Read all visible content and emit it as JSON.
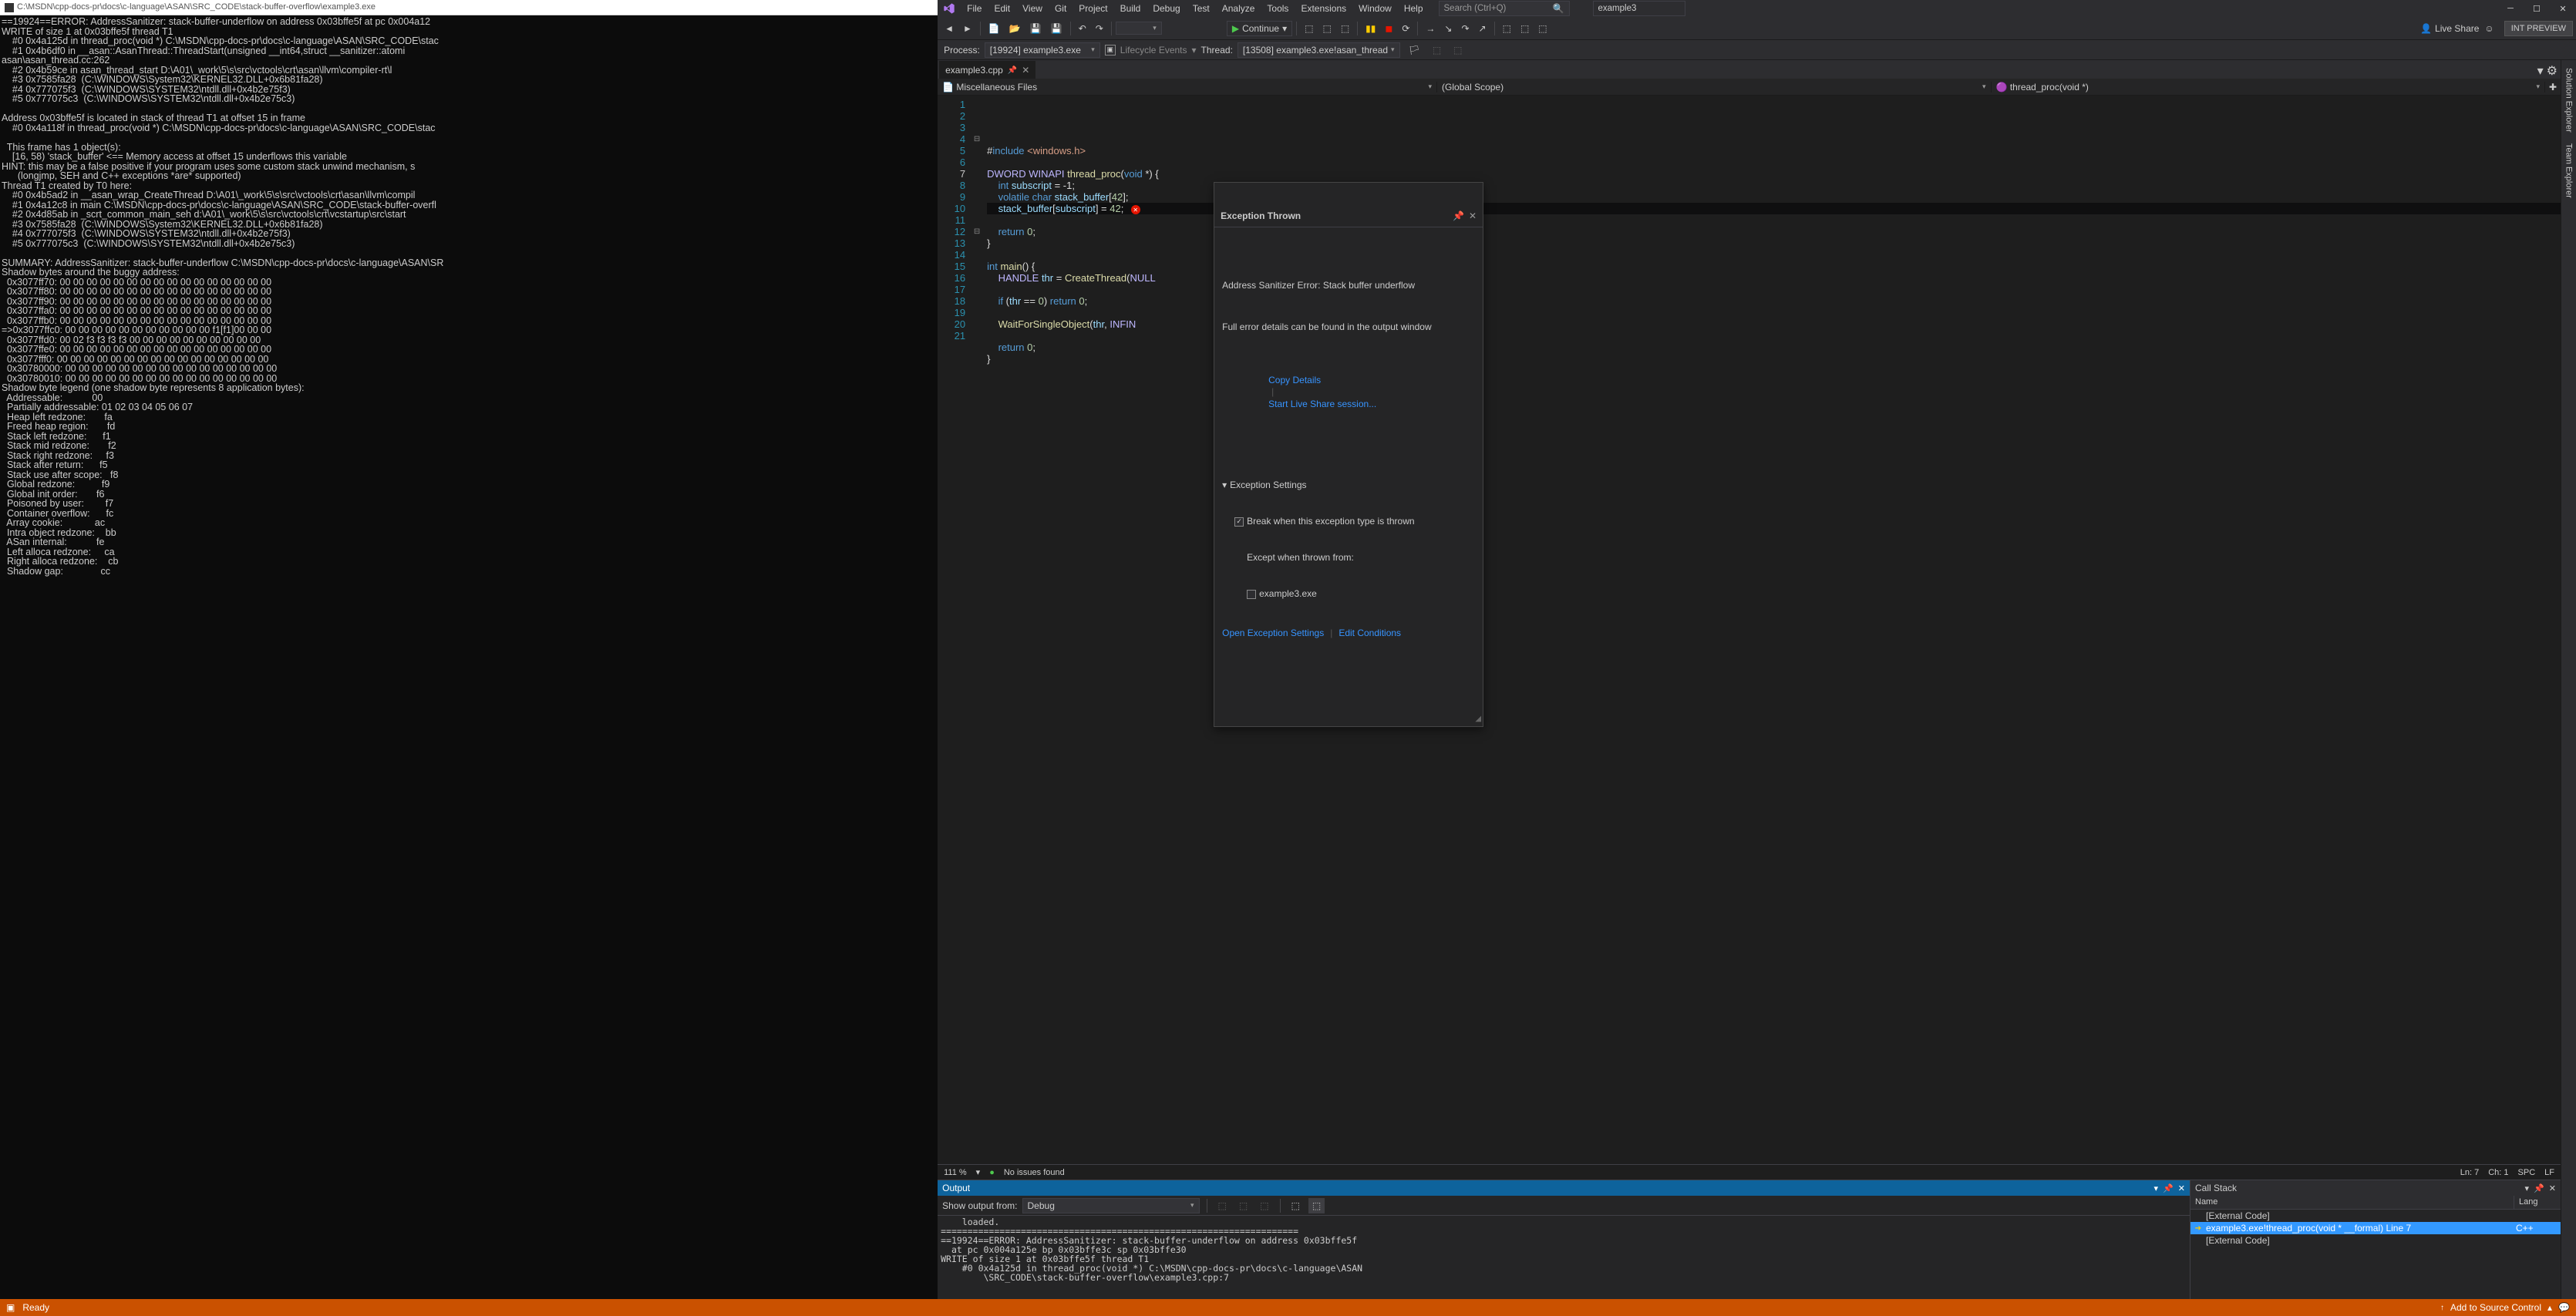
{
  "console": {
    "title": "C:\\MSDN\\cpp-docs-pr\\docs\\c-language\\ASAN\\SRC_CODE\\stack-buffer-overflow\\example3.exe",
    "text": "==19924==ERROR: AddressSanitizer: stack-buffer-underflow on address 0x03bffe5f at pc 0x004a12\nWRITE of size 1 at 0x03bffe5f thread T1\n    #0 0x4a125d in thread_proc(void *) C:\\MSDN\\cpp-docs-pr\\docs\\c-language\\ASAN\\SRC_CODE\\stac\n    #1 0x4b6df0 in __asan::AsanThread::ThreadStart(unsigned __int64,struct __sanitizer::atomi\nasan\\asan_thread.cc:262\n    #2 0x4b59ce in asan_thread_start D:\\A01\\_work\\5\\s\\src\\vctools\\crt\\asan\\llvm\\compiler-rt\\l\n    #3 0x7585fa28  (C:\\WINDOWS\\System32\\KERNEL32.DLL+0x6b81fa28)\n    #4 0x777075f3  (C:\\WINDOWS\\SYSTEM32\\ntdll.dll+0x4b2e75f3)\n    #5 0x777075c3  (C:\\WINDOWS\\SYSTEM32\\ntdll.dll+0x4b2e75c3)\n\nAddress 0x03bffe5f is located in stack of thread T1 at offset 15 in frame\n    #0 0x4a118f in thread_proc(void *) C:\\MSDN\\cpp-docs-pr\\docs\\c-language\\ASAN\\SRC_CODE\\stac\n\n  This frame has 1 object(s):\n    [16, 58) 'stack_buffer' <== Memory access at offset 15 underflows this variable\nHINT: this may be a false positive if your program uses some custom stack unwind mechanism, s\n      (longjmp, SEH and C++ exceptions *are* supported)\nThread T1 created by T0 here:\n    #0 0x4b5ad2 in __asan_wrap_CreateThread D:\\A01\\_work\\5\\s\\src\\vctools\\crt\\asan\\llvm\\compil\n    #1 0x4a12c8 in main C:\\MSDN\\cpp-docs-pr\\docs\\c-language\\ASAN\\SRC_CODE\\stack-buffer-overfl\n    #2 0x4d85ab in _scrt_common_main_seh d:\\A01\\_work\\5\\s\\src\\vctools\\crt\\vcstartup\\src\\start\n    #3 0x7585fa28  (C:\\WINDOWS\\System32\\KERNEL32.DLL+0x6b81fa28)\n    #4 0x777075f3  (C:\\WINDOWS\\SYSTEM32\\ntdll.dll+0x4b2e75f3)\n    #5 0x777075c3  (C:\\WINDOWS\\SYSTEM32\\ntdll.dll+0x4b2e75c3)\n\nSUMMARY: AddressSanitizer: stack-buffer-underflow C:\\MSDN\\cpp-docs-pr\\docs\\c-language\\ASAN\\SR\nShadow bytes around the buggy address:\n  0x3077ff70: 00 00 00 00 00 00 00 00 00 00 00 00 00 00 00 00\n  0x3077ff80: 00 00 00 00 00 00 00 00 00 00 00 00 00 00 00 00\n  0x3077ff90: 00 00 00 00 00 00 00 00 00 00 00 00 00 00 00 00\n  0x3077ffa0: 00 00 00 00 00 00 00 00 00 00 00 00 00 00 00 00\n  0x3077ffb0: 00 00 00 00 00 00 00 00 00 00 00 00 00 00 00 00\n=>0x3077ffc0: 00 00 00 00 00 00 00 00 00 00 00 f1[f1]00 00 00\n  0x3077ffd0: 00 02 f3 f3 f3 f3 00 00 00 00 00 00 00 00 00 00\n  0x3077ffe0: 00 00 00 00 00 00 00 00 00 00 00 00 00 00 00 00\n  0x3077fff0: 00 00 00 00 00 00 00 00 00 00 00 00 00 00 00 00\n  0x30780000: 00 00 00 00 00 00 00 00 00 00 00 00 00 00 00 00\n  0x30780010: 00 00 00 00 00 00 00 00 00 00 00 00 00 00 00 00\nShadow byte legend (one shadow byte represents 8 application bytes):\n  Addressable:           00\n  Partially addressable: 01 02 03 04 05 06 07\n  Heap left redzone:       fa\n  Freed heap region:       fd\n  Stack left redzone:      f1\n  Stack mid redzone:       f2\n  Stack right redzone:     f3\n  Stack after return:      f5\n  Stack use after scope:   f8\n  Global redzone:          f9\n  Global init order:       f6\n  Poisoned by user:        f7\n  Container overflow:      fc\n  Array cookie:            ac\n  Intra object redzone:    bb\n  ASan internal:           fe\n  Left alloca redzone:     ca\n  Right alloca redzone:    cb\n  Shadow gap:              cc"
  },
  "menu": [
    "File",
    "Edit",
    "View",
    "Git",
    "Project",
    "Build",
    "Debug",
    "Test",
    "Analyze",
    "Tools",
    "Extensions",
    "Window",
    "Help"
  ],
  "search_placeholder": "Search (Ctrl+Q)",
  "solution_name": "example3",
  "toolbar": {
    "continue": "Continue",
    "liveshare": "Live Share",
    "intpreview": "INT PREVIEW"
  },
  "debugbar": {
    "process_label": "Process:",
    "process_value": "[19924] example3.exe",
    "lifecycle": "Lifecycle Events",
    "thread_label": "Thread:",
    "thread_value": "[13508] example3.exe!asan_thread"
  },
  "tab": {
    "name": "example3.cpp"
  },
  "navbar": {
    "left": "Miscellaneous Files",
    "mid": "(Global Scope)",
    "right": "thread_proc(void *)"
  },
  "code_lines": [
    "",
    "#include <windows.h>",
    "",
    "DWORD WINAPI thread_proc(void *) {",
    "    int subscript = -1;",
    "    volatile char stack_buffer[42];",
    "    stack_buffer[subscript] = 42;",
    "",
    "    return 0;",
    "}",
    "",
    "int main() {",
    "    HANDLE thr = CreateThread(NULL",
    "",
    "    if (thr == 0) return 0;",
    "",
    "    WaitForSingleObject(thr, INFIN",
    "",
    "    return 0;",
    "}",
    ""
  ],
  "exception": {
    "title": "Exception Thrown",
    "error": "Address Sanitizer Error: Stack buffer underflow",
    "details": "Full error details can be found in the output window",
    "copy": "Copy Details",
    "liveshare": "Start Live Share session...",
    "settings_hdr": "Exception Settings",
    "break_label": "Break when this exception type is thrown",
    "except_label": "Except when thrown from:",
    "except_item": "example3.exe",
    "open_settings": "Open Exception Settings",
    "edit_cond": "Edit Conditions"
  },
  "editor_status": {
    "zoom": "111 %",
    "issues": "No issues found",
    "ln": "Ln: 7",
    "ch": "Ch: 1",
    "spc": "SPC",
    "lf": "LF"
  },
  "output": {
    "title": "Output",
    "show_from_label": "Show output from:",
    "show_from_value": "Debug",
    "text": "    loaded.\n===================================================================\n==19924==ERROR: AddressSanitizer: stack-buffer-underflow on address 0x03bffe5f\n  at pc 0x004a125e bp 0x03bffe3c sp 0x03bffe30\nWRITE of size 1 at 0x03bffe5f thread T1\n    #0 0x4a125d in thread_proc(void *) C:\\MSDN\\cpp-docs-pr\\docs\\c-language\\ASAN\n        \\SRC_CODE\\stack-buffer-overflow\\example3.cpp:7"
  },
  "callstack": {
    "title": "Call Stack",
    "col_name": "Name",
    "col_lang": "Lang",
    "rows": [
      {
        "icon": "",
        "name": "[External Code]",
        "lang": ""
      },
      {
        "icon": "➔",
        "name": "example3.exe!thread_proc(void * __formal) Line 7",
        "lang": "C++",
        "sel": true
      },
      {
        "icon": "",
        "name": "[External Code]",
        "lang": ""
      }
    ]
  },
  "sidetabs": [
    "Solution Explorer",
    "Team Explorer"
  ],
  "status": {
    "ready": "Ready",
    "add_src": "Add to Source Control"
  }
}
